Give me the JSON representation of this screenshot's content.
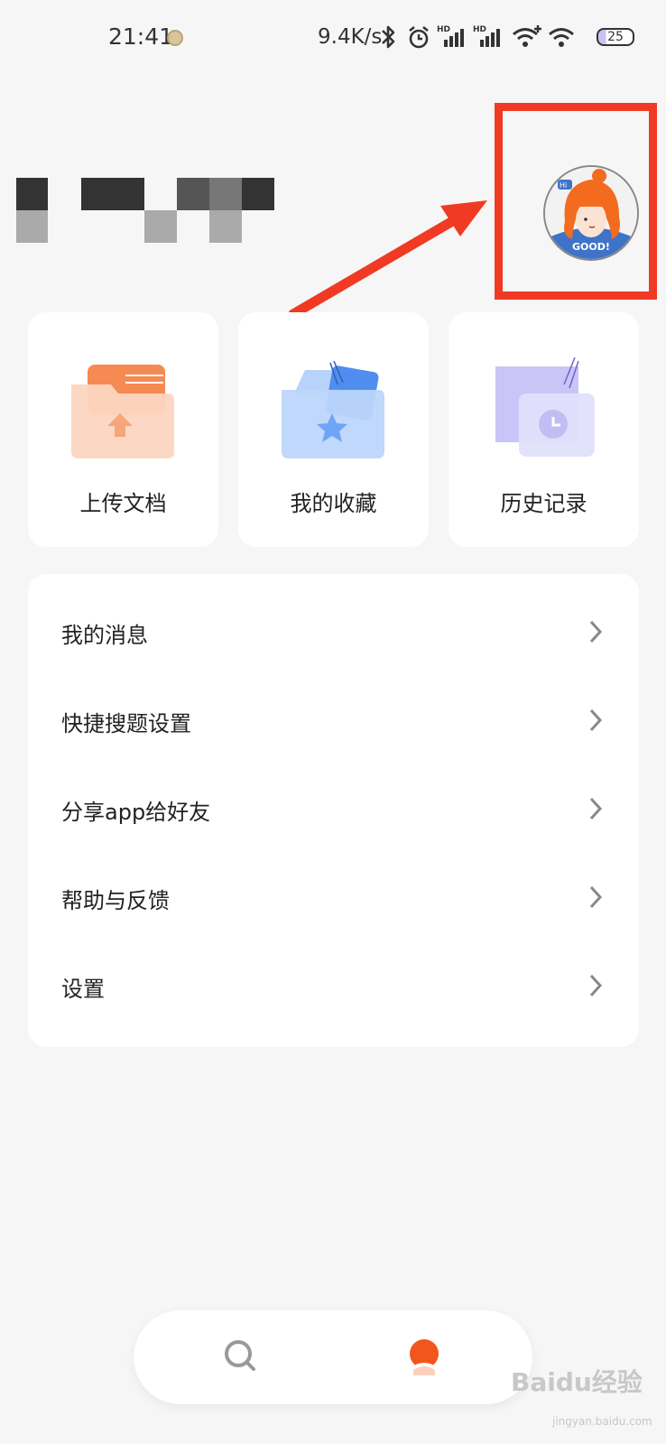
{
  "status_bar": {
    "time": "21:41",
    "speed": "9.4K/s",
    "battery": "25",
    "icons": [
      "app-notification-icon",
      "bluetooth-icon",
      "alarm-icon",
      "signal-hd-icon",
      "signal-hd-icon",
      "wifi-plus-icon",
      "wifi-icon",
      "battery-icon"
    ]
  },
  "profile": {
    "avatar_text": "GOOD!",
    "avatar_bubble": "Hi"
  },
  "quick_actions": [
    {
      "label": "上传文档",
      "icon": "upload-folder-icon"
    },
    {
      "label": "我的收藏",
      "icon": "favorites-folder-icon"
    },
    {
      "label": "历史记录",
      "icon": "history-folder-icon"
    }
  ],
  "menu": [
    {
      "label": "我的消息"
    },
    {
      "label": "快捷搜题设置"
    },
    {
      "label": "分享app给好友"
    },
    {
      "label": "帮助与反馈"
    },
    {
      "label": "设置"
    }
  ],
  "bottom_nav": {
    "items": [
      "search-icon",
      "profile-icon"
    ],
    "active": "profile-icon"
  },
  "watermark": {
    "main": "Baidu经验",
    "sub": "jingyan.baidu.com"
  },
  "colors": {
    "accent": "#f36b1f",
    "highlight": "#f03a24",
    "background": "#f6f6f6"
  }
}
